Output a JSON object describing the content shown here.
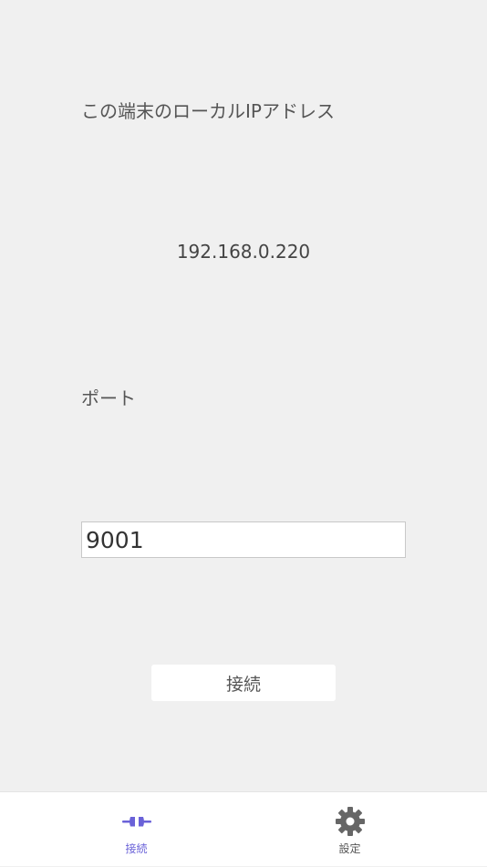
{
  "main": {
    "ip_label": "この端末のローカルIPアドレス",
    "ip_value": "192.168.0.220",
    "port_label": "ポート",
    "port_value": "9001",
    "connect_button_label": "接続"
  },
  "tabbar": {
    "tabs": [
      {
        "label": "接続",
        "icon": "plug-icon",
        "active": true,
        "color": "#6a62d8"
      },
      {
        "label": "設定",
        "icon": "gear-icon",
        "active": false,
        "color": "#555555"
      }
    ]
  }
}
